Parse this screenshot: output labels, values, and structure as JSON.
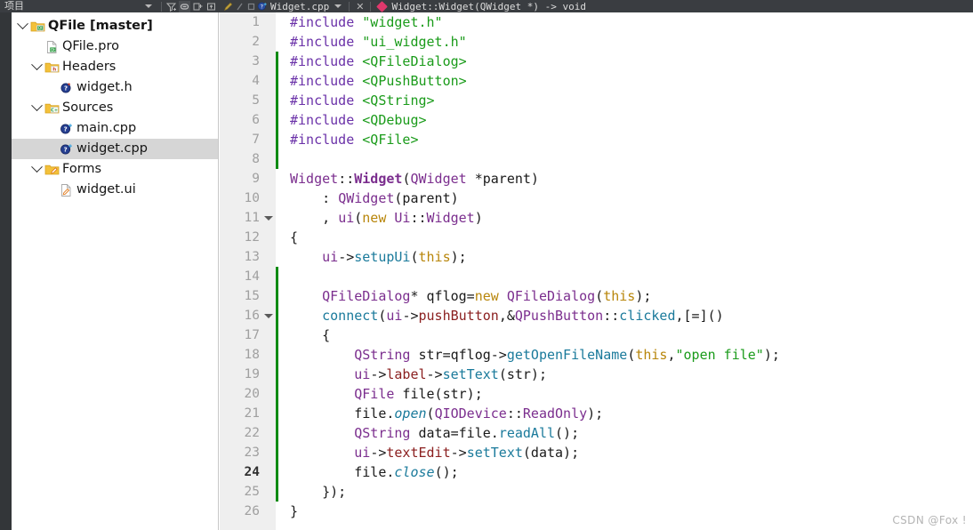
{
  "toolbar": {
    "panel_title": "项目",
    "filter_icon": "filter-icon",
    "link_icon": "link-sync-icon",
    "split_icon": "split-add-icon",
    "collapse_icon": "collapse-icon",
    "pencil_icon": "pencil-icon",
    "slash_icon": "slash-icon",
    "stop_icon": "stop-icon",
    "file_tab_label": "Widget.cpp",
    "file_tab_icon": "cpp-file-icon",
    "tab_chevron_icon": "chevron-down-icon",
    "tab_close_icon": "close-icon",
    "symbol_marker_icon": "pink-diamond-icon",
    "symbol_label": "Widget::Widget(QWidget *) -> void"
  },
  "tree": {
    "items": [
      {
        "label": "QFile [master]",
        "depth": 0,
        "expandable": true,
        "bold": true,
        "icon": "qt-project-folder-icon",
        "selected": false
      },
      {
        "label": "QFile.pro",
        "depth": 1,
        "expandable": false,
        "bold": false,
        "icon": "qt-pro-file-icon",
        "selected": false
      },
      {
        "label": "Headers",
        "depth": 1,
        "expandable": true,
        "bold": false,
        "icon": "headers-folder-icon",
        "selected": false
      },
      {
        "label": "widget.h",
        "depth": 2,
        "expandable": false,
        "bold": false,
        "icon": "header-file-icon",
        "selected": false
      },
      {
        "label": "Sources",
        "depth": 1,
        "expandable": true,
        "bold": false,
        "icon": "sources-folder-icon",
        "selected": false
      },
      {
        "label": "main.cpp",
        "depth": 2,
        "expandable": false,
        "bold": false,
        "icon": "cpp-file-icon",
        "selected": false
      },
      {
        "label": "widget.cpp",
        "depth": 2,
        "expandable": false,
        "bold": false,
        "icon": "cpp-file-icon",
        "selected": true
      },
      {
        "label": "Forms",
        "depth": 1,
        "expandable": true,
        "bold": false,
        "icon": "forms-folder-icon",
        "selected": false
      },
      {
        "label": "widget.ui",
        "depth": 2,
        "expandable": false,
        "bold": false,
        "icon": "ui-file-icon",
        "selected": false
      }
    ]
  },
  "editor": {
    "current_line": 24,
    "lines": [
      {
        "n": 1,
        "changed": false,
        "fold": false,
        "tokens": [
          {
            "t": "#include ",
            "c": "pre"
          },
          {
            "t": "\"widget.h\"",
            "c": "str"
          }
        ]
      },
      {
        "n": 2,
        "changed": false,
        "fold": false,
        "tokens": [
          {
            "t": "#include ",
            "c": "pre"
          },
          {
            "t": "\"ui_widget.h\"",
            "c": "str"
          }
        ]
      },
      {
        "n": 3,
        "changed": true,
        "fold": false,
        "tokens": [
          {
            "t": "#include ",
            "c": "pre"
          },
          {
            "t": "<QFileDialog>",
            "c": "str"
          }
        ]
      },
      {
        "n": 4,
        "changed": true,
        "fold": false,
        "tokens": [
          {
            "t": "#include ",
            "c": "pre"
          },
          {
            "t": "<QPushButton>",
            "c": "str"
          }
        ]
      },
      {
        "n": 5,
        "changed": true,
        "fold": false,
        "tokens": [
          {
            "t": "#include ",
            "c": "pre"
          },
          {
            "t": "<QString>",
            "c": "str"
          }
        ]
      },
      {
        "n": 6,
        "changed": true,
        "fold": false,
        "tokens": [
          {
            "t": "#include ",
            "c": "pre"
          },
          {
            "t": "<QDebug>",
            "c": "str"
          }
        ]
      },
      {
        "n": 7,
        "changed": true,
        "fold": false,
        "tokens": [
          {
            "t": "#include ",
            "c": "pre"
          },
          {
            "t": "<QFile>",
            "c": "str"
          }
        ]
      },
      {
        "n": 8,
        "changed": true,
        "fold": false,
        "tokens": []
      },
      {
        "n": 9,
        "changed": false,
        "fold": false,
        "tokens": [
          {
            "t": "Widget",
            "c": "type"
          },
          {
            "t": "::",
            "c": "plain"
          },
          {
            "t": "Widget",
            "c": "typeb"
          },
          {
            "t": "(",
            "c": "plain"
          },
          {
            "t": "QWidget",
            "c": "type"
          },
          {
            "t": " *parent)",
            "c": "plain"
          }
        ]
      },
      {
        "n": 10,
        "changed": false,
        "fold": false,
        "tokens": [
          {
            "t": "    : ",
            "c": "plain"
          },
          {
            "t": "QWidget",
            "c": "type"
          },
          {
            "t": "(parent)",
            "c": "plain"
          }
        ]
      },
      {
        "n": 11,
        "changed": false,
        "fold": true,
        "tokens": [
          {
            "t": "    , ",
            "c": "plain"
          },
          {
            "t": "ui",
            "c": "type"
          },
          {
            "t": "(",
            "c": "plain"
          },
          {
            "t": "new",
            "c": "kw"
          },
          {
            "t": " ",
            "c": "plain"
          },
          {
            "t": "Ui",
            "c": "type"
          },
          {
            "t": "::",
            "c": "plain"
          },
          {
            "t": "Widget",
            "c": "type"
          },
          {
            "t": ")",
            "c": "plain"
          }
        ]
      },
      {
        "n": 12,
        "changed": false,
        "fold": false,
        "tokens": [
          {
            "t": "{",
            "c": "plain"
          }
        ]
      },
      {
        "n": 13,
        "changed": false,
        "fold": false,
        "tokens": [
          {
            "t": "    ",
            "c": "plain"
          },
          {
            "t": "ui",
            "c": "type"
          },
          {
            "t": "->",
            "c": "plain"
          },
          {
            "t": "setupUi",
            "c": "fn"
          },
          {
            "t": "(",
            "c": "plain"
          },
          {
            "t": "this",
            "c": "kw"
          },
          {
            "t": ");",
            "c": "plain"
          }
        ]
      },
      {
        "n": 14,
        "changed": true,
        "fold": false,
        "tokens": []
      },
      {
        "n": 15,
        "changed": true,
        "fold": false,
        "tokens": [
          {
            "t": "    ",
            "c": "plain"
          },
          {
            "t": "QFileDialog",
            "c": "type"
          },
          {
            "t": "* qflog=",
            "c": "plain"
          },
          {
            "t": "new",
            "c": "kw"
          },
          {
            "t": " ",
            "c": "plain"
          },
          {
            "t": "QFileDialog",
            "c": "type"
          },
          {
            "t": "(",
            "c": "plain"
          },
          {
            "t": "this",
            "c": "kw"
          },
          {
            "t": ");",
            "c": "plain"
          }
        ]
      },
      {
        "n": 16,
        "changed": true,
        "fold": true,
        "tokens": [
          {
            "t": "    ",
            "c": "plain"
          },
          {
            "t": "connect",
            "c": "fn"
          },
          {
            "t": "(",
            "c": "plain"
          },
          {
            "t": "ui",
            "c": "type"
          },
          {
            "t": "->",
            "c": "plain"
          },
          {
            "t": "pushButton",
            "c": "mem"
          },
          {
            "t": ",&",
            "c": "plain"
          },
          {
            "t": "QPushButton",
            "c": "type"
          },
          {
            "t": "::",
            "c": "plain"
          },
          {
            "t": "clicked",
            "c": "fn"
          },
          {
            "t": ",[=]()",
            "c": "plain"
          }
        ]
      },
      {
        "n": 17,
        "changed": true,
        "fold": false,
        "tokens": [
          {
            "t": "    {",
            "c": "plain"
          }
        ]
      },
      {
        "n": 18,
        "changed": true,
        "fold": false,
        "tokens": [
          {
            "t": "        ",
            "c": "plain"
          },
          {
            "t": "QString",
            "c": "type"
          },
          {
            "t": " str=qflog->",
            "c": "plain"
          },
          {
            "t": "getOpenFileName",
            "c": "fn"
          },
          {
            "t": "(",
            "c": "plain"
          },
          {
            "t": "this",
            "c": "kw"
          },
          {
            "t": ",",
            "c": "plain"
          },
          {
            "t": "\"open file\"",
            "c": "str"
          },
          {
            "t": ");",
            "c": "plain"
          }
        ]
      },
      {
        "n": 19,
        "changed": true,
        "fold": false,
        "tokens": [
          {
            "t": "        ",
            "c": "plain"
          },
          {
            "t": "ui",
            "c": "type"
          },
          {
            "t": "->",
            "c": "plain"
          },
          {
            "t": "label",
            "c": "mem"
          },
          {
            "t": "->",
            "c": "plain"
          },
          {
            "t": "setText",
            "c": "fn"
          },
          {
            "t": "(str);",
            "c": "plain"
          }
        ]
      },
      {
        "n": 20,
        "changed": true,
        "fold": false,
        "tokens": [
          {
            "t": "        ",
            "c": "plain"
          },
          {
            "t": "QFile",
            "c": "type"
          },
          {
            "t": " file(str);",
            "c": "plain"
          }
        ]
      },
      {
        "n": 21,
        "changed": true,
        "fold": false,
        "tokens": [
          {
            "t": "        file.",
            "c": "plain"
          },
          {
            "t": "open",
            "c": "fni"
          },
          {
            "t": "(",
            "c": "plain"
          },
          {
            "t": "QIODevice",
            "c": "type"
          },
          {
            "t": "::",
            "c": "plain"
          },
          {
            "t": "ReadOnly",
            "c": "type"
          },
          {
            "t": ");",
            "c": "plain"
          }
        ]
      },
      {
        "n": 22,
        "changed": true,
        "fold": false,
        "tokens": [
          {
            "t": "        ",
            "c": "plain"
          },
          {
            "t": "QString",
            "c": "type"
          },
          {
            "t": " data=file.",
            "c": "plain"
          },
          {
            "t": "readAll",
            "c": "fn"
          },
          {
            "t": "();",
            "c": "plain"
          }
        ]
      },
      {
        "n": 23,
        "changed": true,
        "fold": false,
        "tokens": [
          {
            "t": "        ",
            "c": "plain"
          },
          {
            "t": "ui",
            "c": "type"
          },
          {
            "t": "->",
            "c": "plain"
          },
          {
            "t": "textEdit",
            "c": "mem"
          },
          {
            "t": "->",
            "c": "plain"
          },
          {
            "t": "setText",
            "c": "fn"
          },
          {
            "t": "(data);",
            "c": "plain"
          }
        ]
      },
      {
        "n": 24,
        "changed": true,
        "fold": false,
        "tokens": [
          {
            "t": "        file.",
            "c": "plain"
          },
          {
            "t": "close",
            "c": "fni"
          },
          {
            "t": "();",
            "c": "plain"
          }
        ]
      },
      {
        "n": 25,
        "changed": true,
        "fold": false,
        "tokens": [
          {
            "t": "    });",
            "c": "plain"
          }
        ]
      },
      {
        "n": 26,
        "changed": false,
        "fold": false,
        "tokens": [
          {
            "t": "}",
            "c": "plain"
          }
        ]
      }
    ]
  },
  "watermark": {
    "text": "CSDN @Fox !"
  },
  "colors": {
    "toolbar_bg": "#3a3d41",
    "gutter_bg": "#efefef",
    "change_bar": "#0f8b13",
    "selection_bg": "#d6d6d6",
    "preprocessor": "#6a31a8",
    "string": "#1a9b1a",
    "type": "#7b2e8e",
    "keyword": "#b8860b",
    "function": "#1a7a9b",
    "member": "#8b2020"
  }
}
